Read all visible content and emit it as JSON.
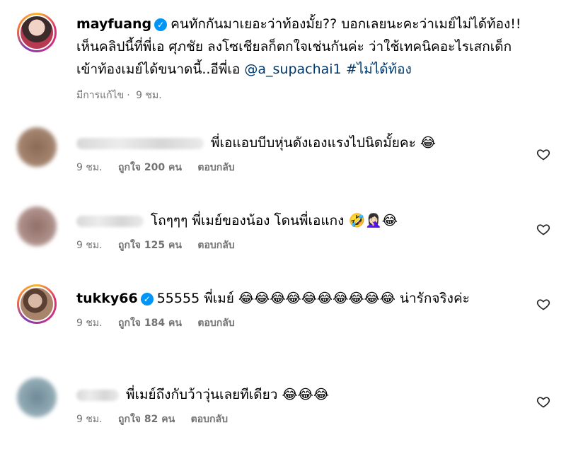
{
  "post": {
    "username": "mayfuang",
    "caption": "คนทักกันมาเยอะว่าท้องมั้ย?? บอกเลยนะคะว่าเมย์ไม่ได้ท้อง!! เห็นคลิปนี้ที่พี่เอ ศุภชัย ลงโซเชียลก็ตกใจเช่นกันค่ะ ว่าใช้เทคนิคอะไรเสกเด็กเข้าท้องเมย์ได้ขนาดนี้..อีพี่เอ",
    "mention": "@a_supachai1",
    "hashtag": "#ไม่ได้ท้อง",
    "edited": "มีการแก้ไข",
    "time": "9 ชม."
  },
  "comments": [
    {
      "text": "พี่เอแอบบีบหุ่นดังเองแรงไปนิดมั้ยคะ 😂",
      "time": "9 ชม.",
      "likes": "ถูกใจ 200 คน",
      "reply": "ตอบกลับ"
    },
    {
      "text": "โถๆๆๆ พี่เมย์ของน้อง โดนพี่เอแกง 🤣🤦🏻‍♀️😂",
      "time": "9 ชม.",
      "likes": "ถูกใจ 125 คน",
      "reply": "ตอบกลับ"
    },
    {
      "username": "tukky66",
      "text": "55555 พี่เมย์ 😂😂😂😂😂😂😂😂😂😂 น่ารักจริงค่ะ",
      "time": "9 ชม.",
      "likes": "ถูกใจ 184 คน",
      "reply": "ตอบกลับ"
    },
    {
      "text": "พี่เมย์ถึงกับว้าวุ่นเลยทีเดียว 😂😂😂",
      "time": "9 ชม.",
      "likes": "ถูกใจ 82 คน",
      "reply": "ตอบกลับ"
    }
  ],
  "icons": {
    "verified": "verified-badge-icon",
    "heart": "heart-outline-icon"
  },
  "colors": {
    "link": "#00376b",
    "verified": "#0095f6",
    "meta": "#737373"
  }
}
